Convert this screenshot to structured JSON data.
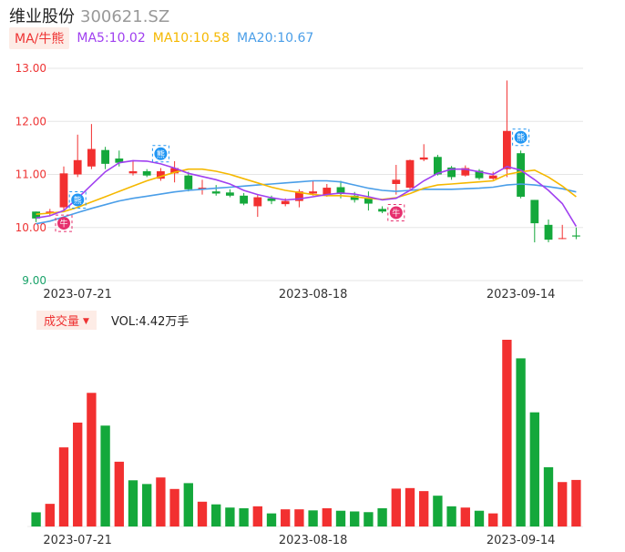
{
  "header": {
    "name": "维业股份",
    "code": "300621.SZ"
  },
  "ma_legend": {
    "toggle_label": "MA/牛熊",
    "ma5_label": "MA5:10.02",
    "ma10_label": "MA10:10.58",
    "ma20_label": "MA20:10.67",
    "ma5_color": "#a040f0",
    "ma10_color": "#f5b800",
    "ma20_color": "#4a9ee8"
  },
  "volume_legend": {
    "toggle_label": "成交量",
    "caret": "▼",
    "vol_label": "VOL:4.42万手"
  },
  "colors": {
    "up": "#f23030",
    "down": "#14a83b",
    "grid": "#e6e6e6",
    "price_tick": "#e33",
    "low_tick": "#1aa36a"
  },
  "markers": {
    "bull": "牛",
    "bear": "熊"
  },
  "chart_data": [
    {
      "type": "candlestick",
      "ylim": [
        9.0,
        13.0
      ],
      "y_ticks": [
        "13.00",
        "12.00",
        "11.00",
        "10.00",
        "9.00"
      ],
      "x_ticks": [
        {
          "index": 3,
          "label": "2023-07-21"
        },
        {
          "index": 20,
          "label": "2023-08-18"
        },
        {
          "index": 35,
          "label": "2023-09-14"
        }
      ],
      "candles": [
        {
          "o": 10.3,
          "c": 10.17,
          "h": 10.3,
          "l": 10.1
        },
        {
          "o": 10.27,
          "c": 10.3,
          "h": 10.35,
          "l": 10.22
        },
        {
          "o": 10.38,
          "c": 11.02,
          "h": 11.15,
          "l": 10.32
        },
        {
          "o": 11.0,
          "c": 11.27,
          "h": 11.75,
          "l": 10.95
        },
        {
          "o": 11.15,
          "c": 11.48,
          "h": 11.95,
          "l": 11.1
        },
        {
          "o": 11.46,
          "c": 11.2,
          "h": 11.52,
          "l": 11.1
        },
        {
          "o": 11.3,
          "c": 11.22,
          "h": 11.45,
          "l": 11.15
        },
        {
          "o": 11.02,
          "c": 11.06,
          "h": 11.27,
          "l": 10.98
        },
        {
          "o": 11.06,
          "c": 10.98,
          "h": 11.1,
          "l": 10.95
        },
        {
          "o": 10.92,
          "c": 11.06,
          "h": 11.12,
          "l": 10.88
        },
        {
          "o": 11.02,
          "c": 11.12,
          "h": 11.25,
          "l": 10.85
        },
        {
          "o": 10.98,
          "c": 10.72,
          "h": 11.05,
          "l": 10.68
        },
        {
          "o": 10.72,
          "c": 10.75,
          "h": 10.9,
          "l": 10.62
        },
        {
          "o": 10.68,
          "c": 10.64,
          "h": 10.8,
          "l": 10.6
        },
        {
          "o": 10.66,
          "c": 10.6,
          "h": 10.72,
          "l": 10.57
        },
        {
          "o": 10.6,
          "c": 10.45,
          "h": 10.65,
          "l": 10.42
        },
        {
          "o": 10.4,
          "c": 10.57,
          "h": 10.62,
          "l": 10.2
        },
        {
          "o": 10.55,
          "c": 10.5,
          "h": 10.6,
          "l": 10.44
        },
        {
          "o": 10.44,
          "c": 10.5,
          "h": 10.55,
          "l": 10.4
        },
        {
          "o": 10.5,
          "c": 10.68,
          "h": 10.72,
          "l": 10.38
        },
        {
          "o": 10.64,
          "c": 10.68,
          "h": 10.88,
          "l": 10.6
        },
        {
          "o": 10.62,
          "c": 10.75,
          "h": 10.82,
          "l": 10.58
        },
        {
          "o": 10.76,
          "c": 10.63,
          "h": 10.88,
          "l": 10.55
        },
        {
          "o": 10.6,
          "c": 10.52,
          "h": 10.67,
          "l": 10.47
        },
        {
          "o": 10.55,
          "c": 10.45,
          "h": 10.68,
          "l": 10.32
        },
        {
          "o": 10.35,
          "c": 10.3,
          "h": 10.4,
          "l": 10.27
        },
        {
          "o": 10.82,
          "c": 10.9,
          "h": 11.18,
          "l": 10.62
        },
        {
          "o": 10.75,
          "c": 11.27,
          "h": 11.28,
          "l": 10.72
        },
        {
          "o": 11.28,
          "c": 11.32,
          "h": 11.57,
          "l": 11.25
        },
        {
          "o": 11.33,
          "c": 11.0,
          "h": 11.37,
          "l": 10.98
        },
        {
          "o": 11.13,
          "c": 10.95,
          "h": 11.16,
          "l": 10.9
        },
        {
          "o": 10.98,
          "c": 11.12,
          "h": 11.17,
          "l": 10.96
        },
        {
          "o": 11.07,
          "c": 10.93,
          "h": 11.1,
          "l": 10.9
        },
        {
          "o": 10.92,
          "c": 10.98,
          "h": 11.05,
          "l": 10.9
        },
        {
          "o": 11.1,
          "c": 11.82,
          "h": 12.77,
          "l": 10.95
        },
        {
          "o": 11.4,
          "c": 10.58,
          "h": 11.45,
          "l": 10.55
        },
        {
          "o": 10.52,
          "c": 10.08,
          "h": 10.52,
          "l": 9.72
        },
        {
          "o": 10.05,
          "c": 9.77,
          "h": 10.15,
          "l": 9.72
        },
        {
          "o": 9.8,
          "c": 9.8,
          "h": 10.05,
          "l": 9.78
        },
        {
          "o": 9.85,
          "c": 9.83,
          "h": 10.0,
          "l": 9.78
        }
      ],
      "ma5": [
        10.18,
        10.22,
        10.32,
        10.55,
        10.8,
        11.05,
        11.22,
        11.26,
        11.25,
        11.2,
        11.12,
        11.02,
        10.96,
        10.9,
        10.82,
        10.7,
        10.62,
        10.56,
        10.52,
        10.54,
        10.58,
        10.62,
        10.65,
        10.63,
        10.58,
        10.52,
        10.55,
        10.7,
        10.88,
        11.02,
        11.1,
        11.1,
        11.05,
        11.0,
        11.15,
        11.08,
        10.9,
        10.7,
        10.45,
        10.02
      ],
      "ma10": [
        10.25,
        10.27,
        10.3,
        10.38,
        10.48,
        10.58,
        10.68,
        10.78,
        10.88,
        10.96,
        11.04,
        11.1,
        11.1,
        11.06,
        11.0,
        10.92,
        10.84,
        10.76,
        10.7,
        10.66,
        10.62,
        10.6,
        10.6,
        10.58,
        10.55,
        10.53,
        10.56,
        10.64,
        10.74,
        10.8,
        10.82,
        10.84,
        10.86,
        10.88,
        11.0,
        11.05,
        11.08,
        10.95,
        10.78,
        10.58
      ],
      "ma20": [
        10.07,
        10.12,
        10.2,
        10.28,
        10.36,
        10.43,
        10.5,
        10.55,
        10.59,
        10.63,
        10.67,
        10.7,
        10.72,
        10.74,
        10.76,
        10.78,
        10.8,
        10.82,
        10.84,
        10.86,
        10.88,
        10.88,
        10.86,
        10.8,
        10.74,
        10.7,
        10.68,
        10.7,
        10.72,
        10.72,
        10.72,
        10.73,
        10.74,
        10.76,
        10.8,
        10.82,
        10.8,
        10.77,
        10.73,
        10.67
      ]
    },
    {
      "type": "bar",
      "title": "成交量",
      "x_ticks": [
        {
          "index": 3,
          "label": "2023-07-21"
        },
        {
          "index": 20,
          "label": "2023-08-18"
        },
        {
          "index": 35,
          "label": "2023-09-14"
        }
      ],
      "values": [
        0.8,
        1.28,
        4.47,
        5.87,
        7.55,
        5.7,
        3.66,
        2.61,
        2.4,
        2.77,
        2.12,
        2.45,
        1.4,
        1.25,
        1.07,
        1.03,
        1.14,
        0.74,
        0.97,
        0.97,
        0.91,
        1.03,
        0.89,
        0.85,
        0.81,
        1.03,
        2.14,
        2.17,
        2.0,
        1.74,
        1.14,
        1.07,
        0.89,
        0.74,
        10.55,
        9.5,
        6.45,
        3.35,
        2.51,
        2.63
      ],
      "directions": [
        "down",
        "up",
        "up",
        "up",
        "up",
        "down",
        "up",
        "down",
        "down",
        "up",
        "up",
        "down",
        "up",
        "down",
        "down",
        "down",
        "up",
        "down",
        "up",
        "up",
        "down",
        "up",
        "down",
        "down",
        "down",
        "down",
        "up",
        "up",
        "up",
        "down",
        "down",
        "up",
        "down",
        "up",
        "up",
        "down",
        "down",
        "down",
        "up",
        "up"
      ]
    }
  ]
}
